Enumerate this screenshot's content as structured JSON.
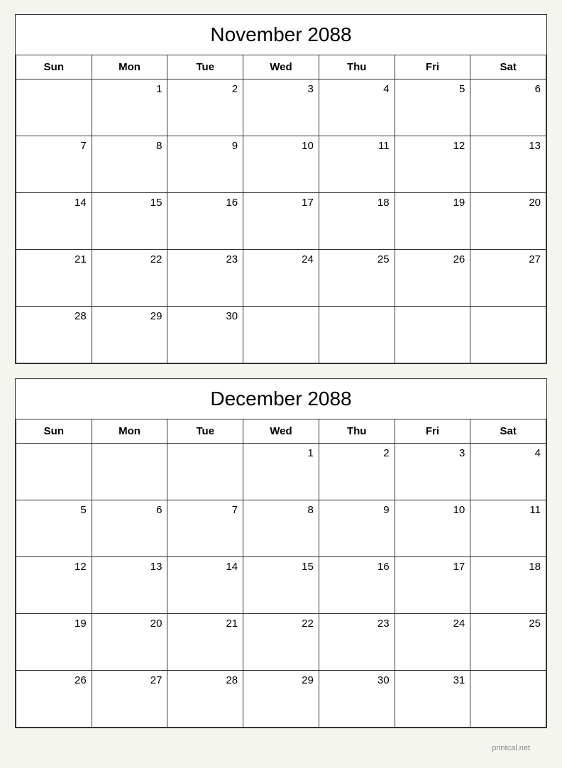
{
  "november": {
    "title": "November 2088",
    "headers": [
      "Sun",
      "Mon",
      "Tue",
      "Wed",
      "Thu",
      "Fri",
      "Sat"
    ],
    "weeks": [
      [
        {
          "day": "",
          "empty": true
        },
        {
          "day": "1"
        },
        {
          "day": "2"
        },
        {
          "day": "3"
        },
        {
          "day": "4"
        },
        {
          "day": "5"
        },
        {
          "day": "6"
        }
      ],
      [
        {
          "day": "7"
        },
        {
          "day": "8"
        },
        {
          "day": "9"
        },
        {
          "day": "10"
        },
        {
          "day": "11"
        },
        {
          "day": "12"
        },
        {
          "day": "13"
        }
      ],
      [
        {
          "day": "14"
        },
        {
          "day": "15"
        },
        {
          "day": "16"
        },
        {
          "day": "17"
        },
        {
          "day": "18"
        },
        {
          "day": "19"
        },
        {
          "day": "20"
        }
      ],
      [
        {
          "day": "21"
        },
        {
          "day": "22"
        },
        {
          "day": "23"
        },
        {
          "day": "24"
        },
        {
          "day": "25"
        },
        {
          "day": "26"
        },
        {
          "day": "27"
        }
      ],
      [
        {
          "day": "28"
        },
        {
          "day": "29"
        },
        {
          "day": "30"
        },
        {
          "day": "",
          "empty": true
        },
        {
          "day": "",
          "empty": true
        },
        {
          "day": "",
          "empty": true
        },
        {
          "day": "",
          "empty": true
        }
      ]
    ]
  },
  "december": {
    "title": "December 2088",
    "headers": [
      "Sun",
      "Mon",
      "Tue",
      "Wed",
      "Thu",
      "Fri",
      "Sat"
    ],
    "weeks": [
      [
        {
          "day": "",
          "empty": true
        },
        {
          "day": "",
          "empty": true
        },
        {
          "day": "",
          "empty": true
        },
        {
          "day": "1"
        },
        {
          "day": "2"
        },
        {
          "day": "3"
        },
        {
          "day": "4"
        }
      ],
      [
        {
          "day": "5"
        },
        {
          "day": "6"
        },
        {
          "day": "7"
        },
        {
          "day": "8"
        },
        {
          "day": "9"
        },
        {
          "day": "10"
        },
        {
          "day": "11"
        }
      ],
      [
        {
          "day": "12"
        },
        {
          "day": "13"
        },
        {
          "day": "14"
        },
        {
          "day": "15"
        },
        {
          "day": "16"
        },
        {
          "day": "17"
        },
        {
          "day": "18"
        }
      ],
      [
        {
          "day": "19"
        },
        {
          "day": "20"
        },
        {
          "day": "21"
        },
        {
          "day": "22"
        },
        {
          "day": "23"
        },
        {
          "day": "24"
        },
        {
          "day": "25"
        }
      ],
      [
        {
          "day": "26"
        },
        {
          "day": "27"
        },
        {
          "day": "28"
        },
        {
          "day": "29"
        },
        {
          "day": "30"
        },
        {
          "day": "31"
        },
        {
          "day": "",
          "empty": true
        }
      ]
    ]
  },
  "watermark": "printcal.net"
}
